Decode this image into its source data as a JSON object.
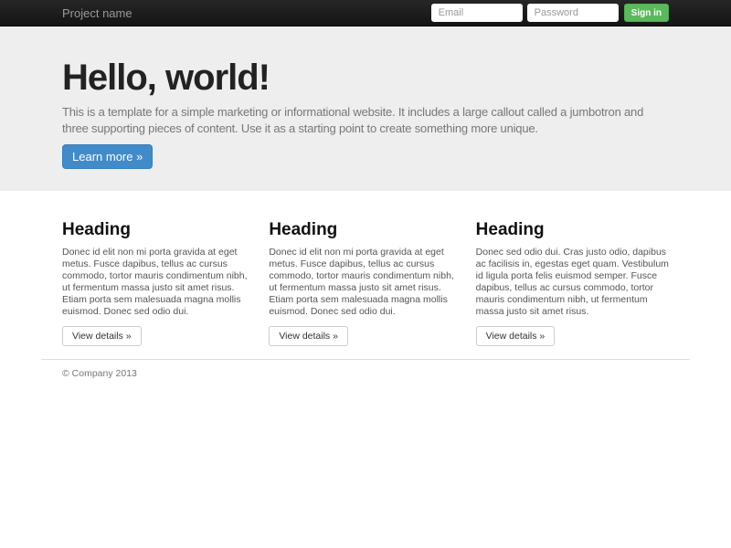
{
  "navbar": {
    "brand": "Project name",
    "email_placeholder": "Email",
    "password_placeholder": "Password",
    "signin_label": "Sign in"
  },
  "jumbotron": {
    "title": "Hello, world!",
    "description": "This is a template for a simple marketing or informational website. It includes a large callout called a jumbotron and three supporting pieces of content. Use it as a starting point to create something more unique.",
    "cta_label": "Learn more »"
  },
  "columns": [
    {
      "heading": "Heading",
      "text": "Donec id elit non mi porta gravida at eget metus. Fusce dapibus, tellus ac cursus commodo, tortor mauris condimentum nibh, ut fermentum massa justo sit amet risus. Etiam porta sem malesuada magna mollis euismod. Donec sed odio dui.",
      "button_label": "View details »"
    },
    {
      "heading": "Heading",
      "text": "Donec id elit non mi porta gravida at eget metus. Fusce dapibus, tellus ac cursus commodo, tortor mauris condimentum nibh, ut fermentum massa justo sit amet risus. Etiam porta sem malesuada magna mollis euismod. Donec sed odio dui.",
      "button_label": "View details »"
    },
    {
      "heading": "Heading",
      "text": "Donec sed odio dui. Cras justo odio, dapibus ac facilisis in, egestas eget quam. Vestibulum id ligula porta felis euismod semper. Fusce dapibus, tellus ac cursus commodo, tortor mauris condimentum nibh, ut fermentum massa justo sit amet risus.",
      "button_label": "View details »"
    }
  ],
  "footer": {
    "copyright": "© Company 2013"
  },
  "colors": {
    "navbar_bg": "#1b1b1b",
    "jumbotron_bg": "#eeeeee",
    "primary": "#428bca",
    "success": "#5cb85c"
  }
}
